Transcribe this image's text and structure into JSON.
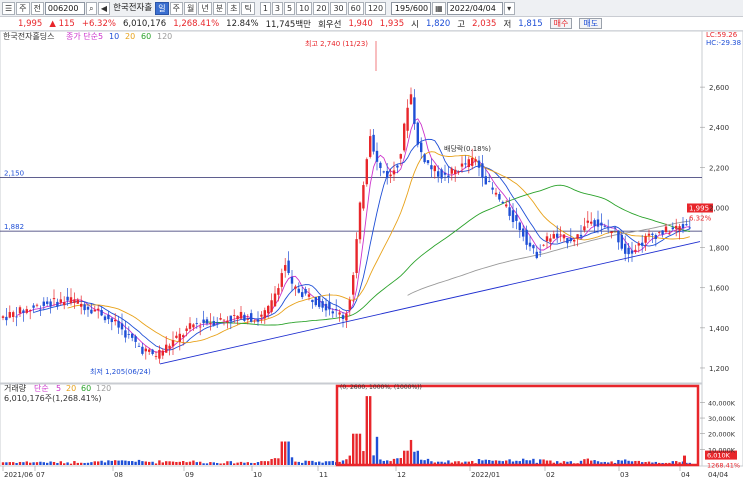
{
  "toolbar": {
    "menu_icon": "menu-icon",
    "sub_label": "주",
    "market_label": "전",
    "code": "006200",
    "search_icon": "search-icon",
    "speaker_icon": "speaker-icon",
    "stock_name": "한국전자홀",
    "period_buttons": [
      {
        "label": "일",
        "active": true
      },
      {
        "label": "주",
        "active": false
      },
      {
        "label": "월",
        "active": false
      },
      {
        "label": "년",
        "active": false
      },
      {
        "label": "분",
        "active": false
      },
      {
        "label": "초",
        "active": false
      },
      {
        "label": "틱",
        "active": false
      }
    ],
    "interval_buttons": [
      "1",
      "3",
      "5",
      "10",
      "20",
      "30",
      "60",
      "120"
    ],
    "range": "195/600",
    "date": "2022/04/04"
  },
  "infobar": {
    "price": "1,995",
    "change_arrow": "▲",
    "change": "115",
    "change_pct": "+6.32%",
    "volume": "6,010,176",
    "volume_ratio": "1,268.41%",
    "turnover": "12.84%",
    "amount": "11,745백만",
    "open_label": "회우선",
    "open_price": "1,940",
    "open2": "1,935",
    "time_label": "시",
    "time_price": "1,820",
    "high_label": "고",
    "high_price": "2,035",
    "low_label": "저",
    "low_price": "1,815",
    "buy_label": "매수",
    "sell_label": "매도"
  },
  "chart": {
    "name": "한국전자홀딩스",
    "ma_label": "종가 단순",
    "ma_periods": [
      "5",
      "10",
      "20",
      "60",
      "120"
    ],
    "lc": "LC:59.26",
    "hc": "HC:-29.38",
    "high_annotation": "최고 2,740 (11/23)",
    "low_annotation": "최저 1,205(06/24)",
    "mid_annotation": "배당락(0.18%)",
    "ref_line_1": "2,150",
    "ref_line_2": "1,882",
    "current_price_tag": "1,995",
    "current_change_tag": "6.32%",
    "y_ticks": [
      "2,600",
      "2,400",
      "2,200",
      "2,000",
      "1,800",
      "1,600",
      "1,400",
      "1,200"
    ],
    "x_labels": [
      "2021/06",
      "07",
      "08",
      "09",
      "10",
      "11",
      "12",
      "2022/01",
      "02",
      "03",
      "04"
    ],
    "current_date": "04/04",
    "colors": {
      "up": "#e8262b",
      "down": "#1f4fd6",
      "ma5": "#cc33cc",
      "ma10": "#1f4fd6",
      "ma20": "#e8a21a",
      "ma60": "#2aa22a",
      "ma120": "#9a9a9a"
    }
  },
  "volume": {
    "title": "거래량",
    "ma_label": "단순",
    "ma_periods": [
      "5",
      "20",
      "60",
      "120"
    ],
    "current": "6,010,176주(1,268.41%)",
    "y_ticks": [
      "40,000K",
      "30,000K",
      "20,000K",
      "10,000K"
    ],
    "current_tag": "6,010K",
    "current_pct_tag": "1268.41%",
    "overlay_text": "(0, 2600, 1000%, (1000%))"
  },
  "chart_data": {
    "type": "candlestick",
    "series": [
      {
        "name": "price",
        "points": []
      }
    ],
    "ylim": [
      1160,
      2780
    ],
    "volume_ylim": [
      0,
      46000
    ]
  }
}
